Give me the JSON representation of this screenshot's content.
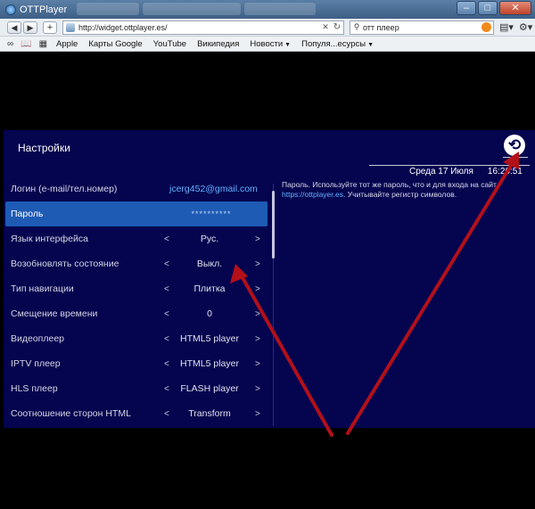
{
  "browser": {
    "window_title": "OTTPlayer",
    "url": "http://widget.ottplayer.es/",
    "search_text": "отт плеер",
    "bookmarks": [
      {
        "label": "Apple"
      },
      {
        "label": "Карты Google"
      },
      {
        "label": "YouTube"
      },
      {
        "label": "Википедия"
      },
      {
        "label": "Новости"
      },
      {
        "label": "Популя...есурсы"
      }
    ]
  },
  "settings": {
    "title": "Настройки",
    "date": "Среда 17 Июля",
    "time": "16:26:51",
    "rows": [
      {
        "label": "Логин (e-mail/тел.номер)",
        "value": "jcerg452@gmail.com",
        "arrows": false
      },
      {
        "label": "Пароль",
        "value": "**********",
        "arrows": false,
        "selected": true
      },
      {
        "label": "Язык интерфейса",
        "value": "Рус.",
        "arrows": true
      },
      {
        "label": "Возобновлять состояние",
        "value": "Выкл.",
        "arrows": true
      },
      {
        "label": "Тип навигации",
        "value": "Плитка",
        "arrows": true
      },
      {
        "label": "Смещение времени",
        "value": "0",
        "arrows": true
      },
      {
        "label": "Видеоплеер",
        "value": "HTML5 player",
        "arrows": true
      },
      {
        "label": "IPTV плеер",
        "value": "HTML5 player",
        "arrows": true
      },
      {
        "label": "HLS плеер",
        "value": "FLASH player",
        "arrows": true
      },
      {
        "label": "Соотношение сторон HTML",
        "value": "Transform",
        "arrows": true
      }
    ],
    "arrow_left": "<",
    "arrow_right": ">",
    "help": {
      "line1": "Пароль. Используйте тот же пароль, что и для входа на сайт",
      "link": "https://ottplayer.es",
      "line2_rest": ". Учитывайте регистр символов."
    }
  },
  "colors": {
    "app_bg": "#04044f",
    "selected_row": "#1e5bb5",
    "link": "#63b3ff",
    "annotation_arrow": "#b3101a"
  }
}
